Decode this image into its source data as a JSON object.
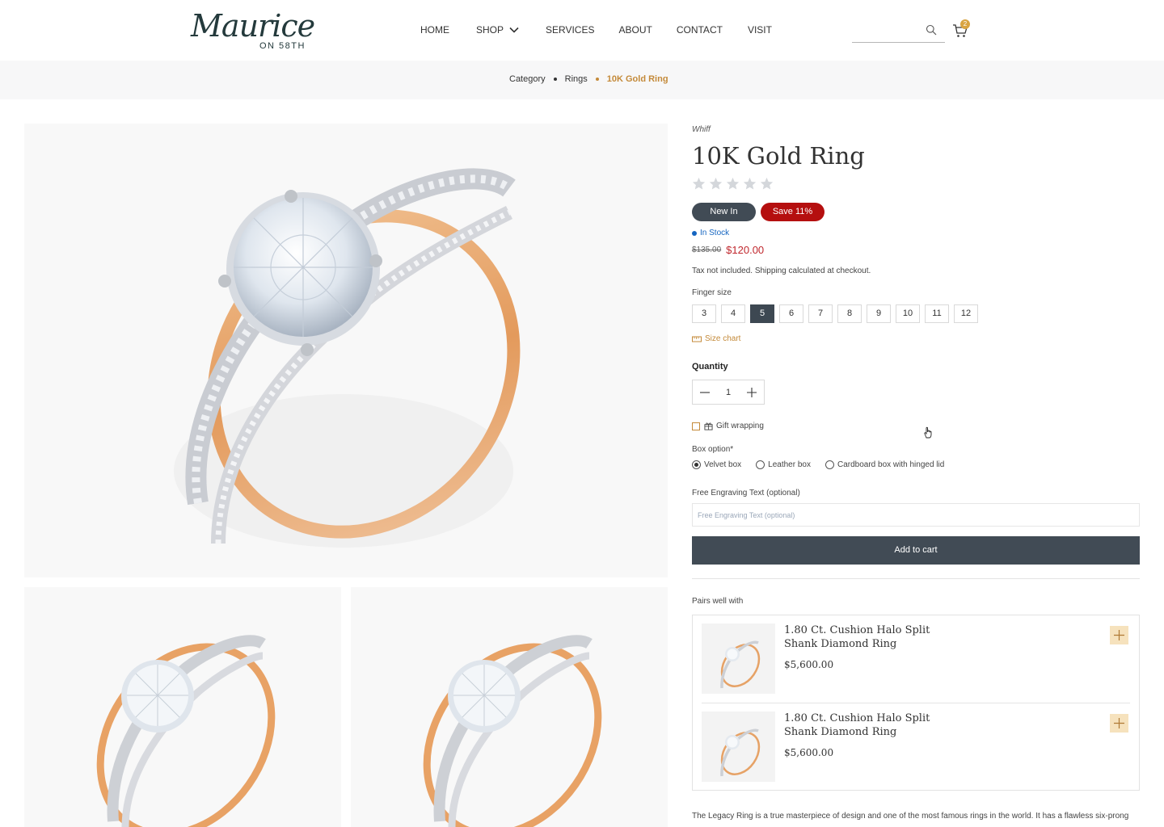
{
  "header": {
    "logo_script": "Maurice",
    "logo_sub": "ON 58TH",
    "nav": [
      "HOME",
      "SHOP",
      "SERVICES",
      "ABOUT",
      "CONTACT",
      "VISIT"
    ],
    "search_placeholder": "",
    "cart_count": "2"
  },
  "breadcrumb": [
    "Category",
    "Rings",
    "10K Gold Ring"
  ],
  "product": {
    "vendor": "Whiff",
    "title": "10K Gold Ring",
    "rating": 0,
    "badge_new": "New In",
    "badge_save": "Save 11%",
    "stock": "In Stock",
    "price_old": "$135.00",
    "price_new": "$120.00",
    "tax_note": "Tax not included. Shipping calculated at checkout.",
    "size_label": "Finger size",
    "sizes": [
      "3",
      "4",
      "5",
      "6",
      "7",
      "8",
      "9",
      "10",
      "11",
      "12"
    ],
    "selected_size": "5",
    "size_chart": "Size chart",
    "quantity_label": "Quantity",
    "quantity": "1",
    "gift_label": "Gift wrapping",
    "box_label": "Box option*",
    "box_options": [
      "Velvet box",
      "Leather box",
      "Cardboard box with hinged lid"
    ],
    "box_selected": "Velvet box",
    "engrave_label": "Free Engraving Text (optional)",
    "engrave_placeholder": "Free Engraving Text (optional)",
    "add_to_cart": "Add to cart"
  },
  "pairs": {
    "label": "Pairs well with",
    "items": [
      {
        "name": "1.80 Ct. Cushion Halo Split Shank Diamond Ring",
        "price": "$5,600.00"
      },
      {
        "name": "1.80 Ct. Cushion Halo Split Shank Diamond Ring",
        "price": "$5,600.00"
      }
    ]
  },
  "description": "The Legacy Ring is a true masterpiece of design and one of the most famous rings in the world. It has a flawless six-prong",
  "colors": {
    "primary": "#414b55",
    "gold": "#c48a3a",
    "sale": "#b50f0f",
    "stock": "#1565c0"
  }
}
